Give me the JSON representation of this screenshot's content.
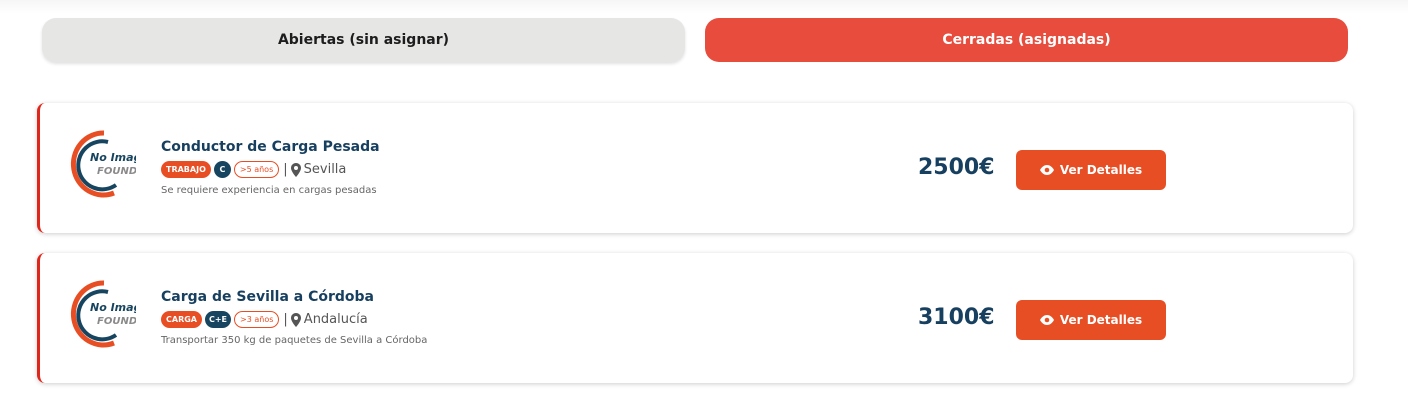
{
  "tabs": {
    "open_label": "Abiertas (sin asignar)",
    "closed_label": "Cerradas (asignadas)"
  },
  "logo": {
    "line1": "No Image",
    "line2": "FOUND"
  },
  "listings": [
    {
      "title": "Conductor de Carga Pesada",
      "type_tag": "TRABAJO",
      "license_tag": "C",
      "experience_tag": ">5 años",
      "separator": "|",
      "location": "Sevilla",
      "description": "Se requiere experiencia en cargas pesadas",
      "price": "2500€",
      "button_label": "Ver Detalles"
    },
    {
      "title": "Carga de Sevilla a Córdoba",
      "type_tag": "CARGA",
      "license_tag": "C+E",
      "experience_tag": ">3 años",
      "separator": "|",
      "location": "Andalucía",
      "description": "Transportar 350 kg de paquetes de Sevilla a Córdoba",
      "price": "3100€",
      "button_label": "Ver Detalles"
    }
  ],
  "icons": {
    "location": "map-pin-icon",
    "view": "eye-icon"
  },
  "colors": {
    "accent": "#e84e24",
    "active_tab": "#e74c3c",
    "title": "#173f5f",
    "card_border": "#e0251a"
  }
}
